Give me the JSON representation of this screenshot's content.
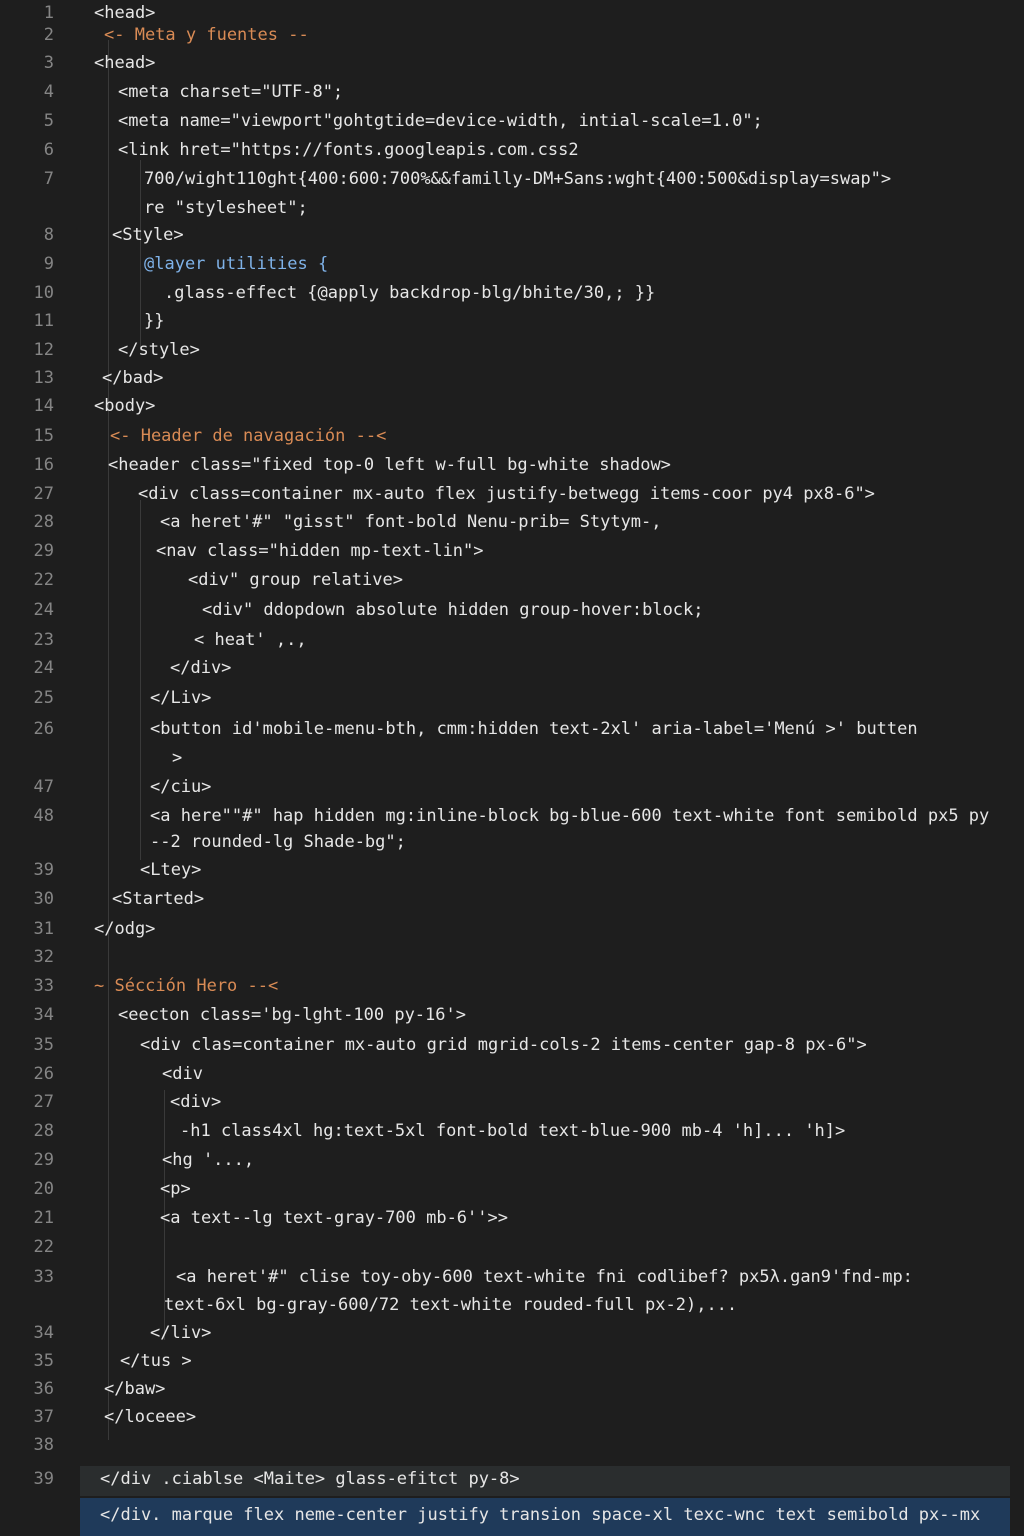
{
  "editor": {
    "lines": [
      {
        "num": "1",
        "code": "<head>"
      },
      {
        "num": "2",
        "code": "<- Meta y fuentes --"
      },
      {
        "num": "3",
        "code": "<head>"
      },
      {
        "num": "4",
        "code": "<meta charset=\"UTF-8\";"
      },
      {
        "num": "5",
        "code": "<meta name=\"viewport\"gohtgtide=device-width, intial-scale=1.0\";"
      },
      {
        "num": "6",
        "code": "<link hret=\"https://fonts.googleapis.com.css2"
      },
      {
        "num": "7",
        "code": "700/wight110ght{400:600:700%&&familly-DM+Sans:wght{400:500&display=swap\">"
      },
      {
        "num": "",
        "code": "re \"stylesheet\";"
      },
      {
        "num": "8",
        "code": "<Style>"
      },
      {
        "num": "9",
        "code": "@layer utilities {"
      },
      {
        "num": "10",
        "code": ".glass-effect {@apply backdrop-blg/bhite/30,; }}"
      },
      {
        "num": "11",
        "code": "}}"
      },
      {
        "num": "12",
        "code": "</style>"
      },
      {
        "num": "13",
        "code": "</bad>"
      },
      {
        "num": "14",
        "code": "<body>"
      },
      {
        "num": "15",
        "code": "<- Header de navagación --<"
      },
      {
        "num": "16",
        "code": "<header class=\"fixed top-0 left w-full bg-white shadow>"
      },
      {
        "num": "27",
        "code": "<div class=container mx-auto flex justify-betwegg items-coor py4 px8-6\">"
      },
      {
        "num": "28",
        "code": "<a heret'#\" \"gisst\" font-bold Nenu-prib= Stytym-,"
      },
      {
        "num": "29",
        "code": "<nav class=\"hidden mp-text-lin\">"
      },
      {
        "num": "22",
        "code": "<div\" group relative>"
      },
      {
        "num": "24",
        "code": "<div\" ddopdown absolute hidden group-hover:block;"
      },
      {
        "num": "23",
        "code": "< heat' ,.,"
      },
      {
        "num": "24",
        "code": "</div>"
      },
      {
        "num": "25",
        "code": "</Liv>"
      },
      {
        "num": "26",
        "code": "<button id'mobile-menu-bth, cmm:hidden text-2xl' aria-label='Menú >' butten"
      },
      {
        "num": "",
        "code": ">"
      },
      {
        "num": "47",
        "code": "</ciu>"
      },
      {
        "num": "48",
        "code": "<a here\"\"#\" hap hidden mg:inline-block bg-blue-600 text-white font semibold px5 py"
      },
      {
        "num": "",
        "code": "--2 rounded-lg Shade-bg\";"
      },
      {
        "num": "39",
        "code": "<Ltey>"
      },
      {
        "num": "30",
        "code": "<Started>"
      },
      {
        "num": "31",
        "code": "</odg>"
      },
      {
        "num": "32",
        "code": ""
      },
      {
        "num": "33",
        "code": "~ Sécción Hero --<"
      },
      {
        "num": "34",
        "code": "<eecton class='bg-lght-100 py-16'>"
      },
      {
        "num": "35",
        "code": "<div clas=container mx-auto grid mgrid-cols-2 items-center gap-8 px-6\">"
      },
      {
        "num": "26",
        "code": "<div"
      },
      {
        "num": "27",
        "code": "<div>"
      },
      {
        "num": "28",
        "code": "-h1 class4xl hg:text-5xl font-bold text-blue-900 mb-4 'h]... 'h]>"
      },
      {
        "num": "29",
        "code": "<hg '...,"
      },
      {
        "num": "20",
        "code": "<p>"
      },
      {
        "num": "21",
        "code": "<a text--lg text-gray-700 mb-6''>>"
      },
      {
        "num": "22",
        "code": ""
      },
      {
        "num": "33",
        "code": "<a heret'#\" clise toy-oby-600 text-white fni codlibef? px5λ.gan9'fnd-mp:"
      },
      {
        "num": "",
        "code": "text-6xl bg-gray-600/72 text-white rouded-full px-2),..."
      },
      {
        "num": "34",
        "code": "</liv>"
      },
      {
        "num": "35",
        "code": "</tus >"
      },
      {
        "num": "36",
        "code": "</baw>"
      },
      {
        "num": "37",
        "code": "</loceee>"
      },
      {
        "num": "38",
        "code": ""
      },
      {
        "num": "39",
        "code": "</div .ciablse <Maite> glass-efitct py-8>"
      },
      {
        "num": "",
        "code": "</div. marque flex neme-center justify transion space-xl texc-wnc text semibold px--mx"
      }
    ]
  }
}
